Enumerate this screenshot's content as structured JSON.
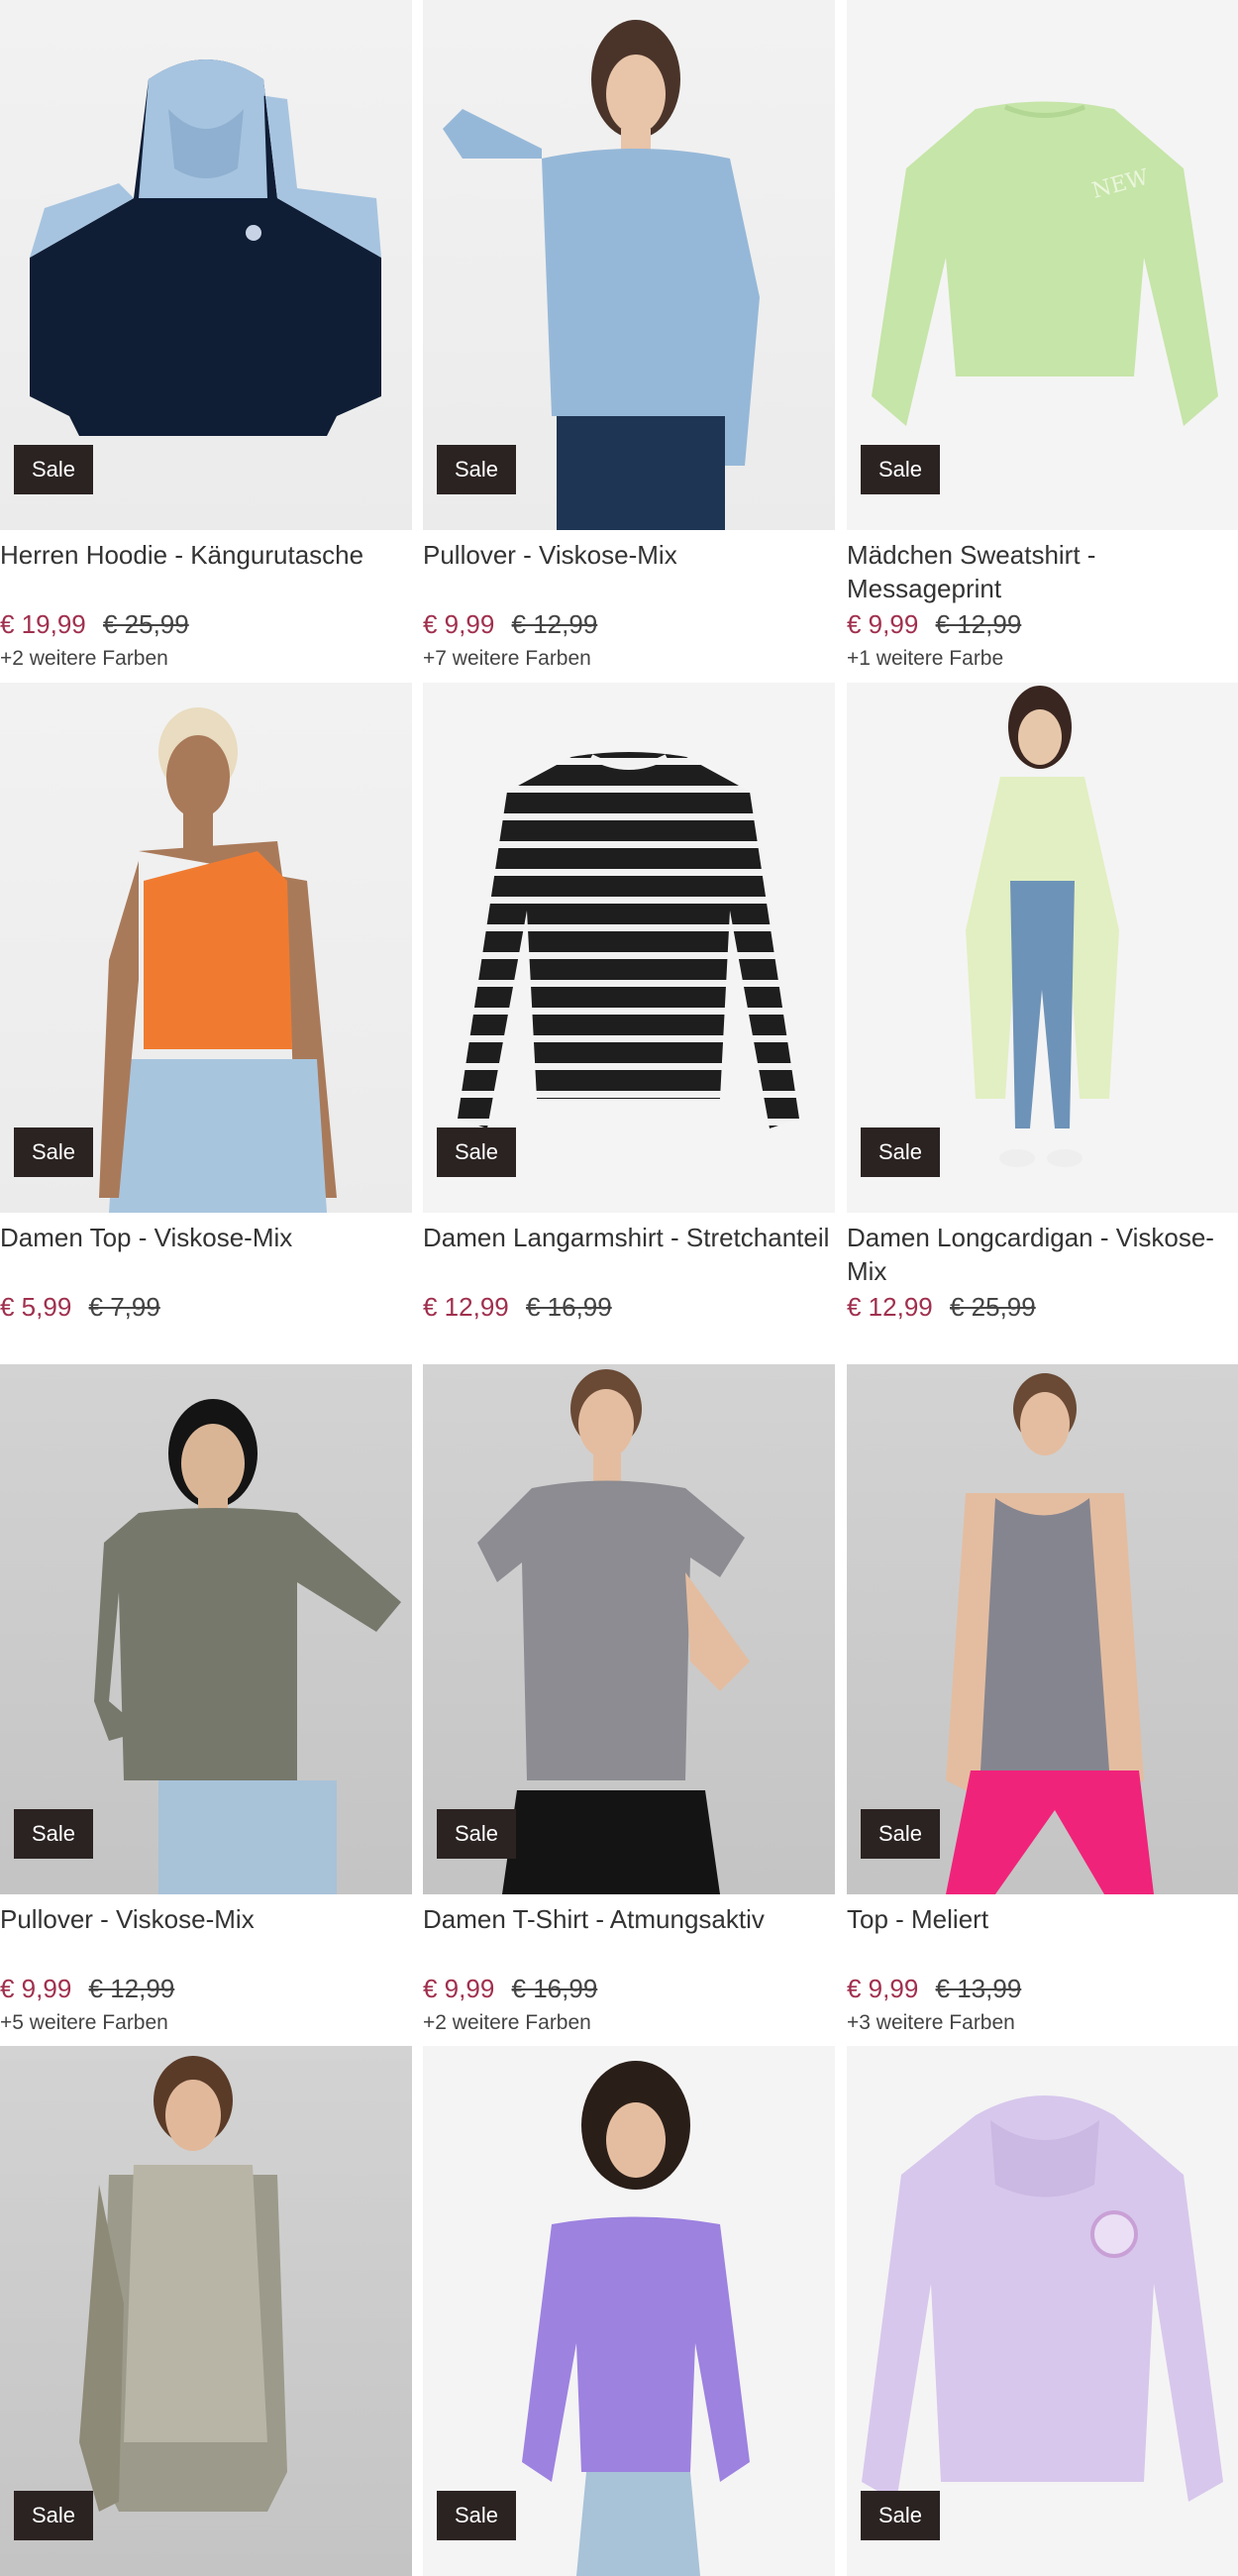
{
  "colors": {
    "sale_bg": "#2b2322",
    "price_sale": "#a0304e"
  },
  "badge_label": "Sale",
  "products": [
    {
      "title": "Herren Hoodie - Kängurutasche",
      "price": "€ 19,99",
      "old_price": "€ 25,99",
      "colors": "+2 weitere Farben"
    },
    {
      "title": "Pullover - Viskose-Mix",
      "price": "€ 9,99",
      "old_price": "€ 12,99",
      "colors": "+7 weitere Farben"
    },
    {
      "title": "Mädchen Sweatshirt - Messageprint",
      "price": "€ 9,99",
      "old_price": "€ 12,99",
      "colors": "+1 weitere Farbe"
    },
    {
      "title": "Damen Top - Viskose-Mix",
      "price": "€ 5,99",
      "old_price": "€ 7,99",
      "colors": ""
    },
    {
      "title": "Damen Langarmshirt - Stretchanteil",
      "price": "€ 12,99",
      "old_price": "€ 16,99",
      "colors": ""
    },
    {
      "title": "Damen Longcardigan - Viskose-Mix",
      "price": "€ 12,99",
      "old_price": "€ 25,99",
      "colors": ""
    },
    {
      "title": "Pullover - Viskose-Mix",
      "price": "€ 9,99",
      "old_price": "€ 12,99",
      "colors": "+5 weitere Farben"
    },
    {
      "title": "Damen T-Shirt - Atmungsaktiv",
      "price": "€ 9,99",
      "old_price": "€ 16,99",
      "colors": "+2 weitere Farben"
    },
    {
      "title": "Top - Meliert",
      "price": "€ 9,99",
      "old_price": "€ 13,99",
      "colors": "+3 weitere Farben"
    },
    {
      "title": "",
      "price": "",
      "old_price": "",
      "colors": ""
    },
    {
      "title": "",
      "price": "",
      "old_price": "",
      "colors": ""
    },
    {
      "title": "",
      "price": "",
      "old_price": "",
      "colors": ""
    }
  ]
}
